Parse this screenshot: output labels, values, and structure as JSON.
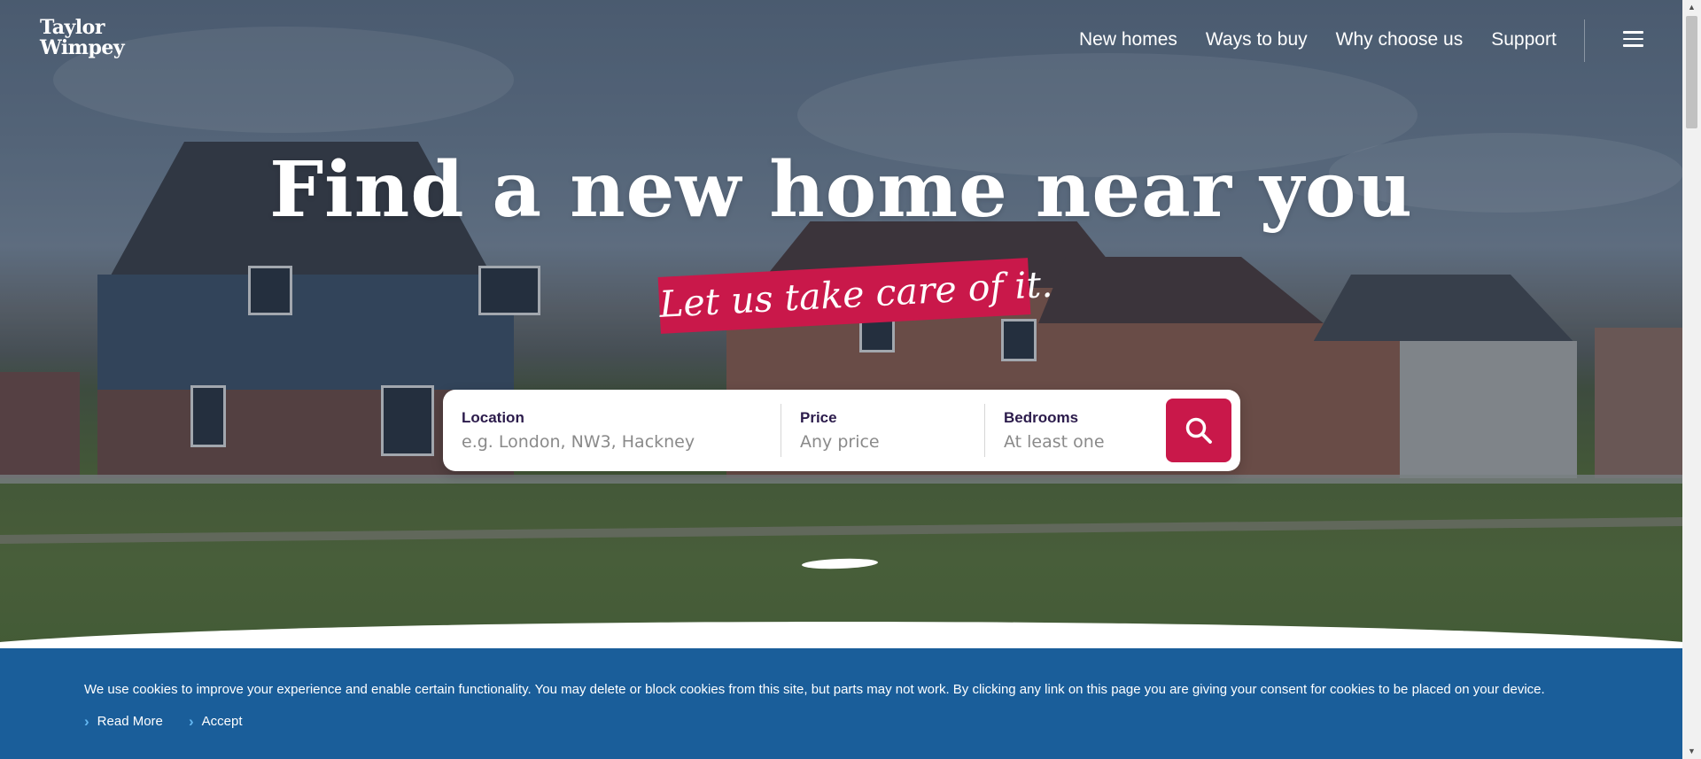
{
  "brand": {
    "logo_line1": "Taylor",
    "logo_line2": "Wimpey"
  },
  "nav": {
    "items": [
      {
        "label": "New homes"
      },
      {
        "label": "Ways to buy"
      },
      {
        "label": "Why choose us"
      },
      {
        "label": "Support"
      }
    ],
    "menu_icon": "hamburger-menu-icon"
  },
  "hero": {
    "headline": "Find a new home near you",
    "tagline": "Let us take care of it."
  },
  "search": {
    "location": {
      "label": "Location",
      "placeholder": "e.g. London, NW3, Hackney"
    },
    "price": {
      "label": "Price",
      "value": "Any price"
    },
    "bedrooms": {
      "label": "Bedrooms",
      "value": "At least one"
    },
    "button_icon": "search-icon"
  },
  "cookie_banner": {
    "message": "We use cookies to improve your experience and enable certain functionality. You may delete or block cookies from this site, but parts may not work. By clicking any link on this page you are giving your consent for cookies to be placed on your device.",
    "read_more": "Read More",
    "accept": "Accept"
  },
  "colors": {
    "brand_red": "#c9184a",
    "cookie_blue": "#1a5e9a",
    "label_purple": "#2b1b4b"
  }
}
